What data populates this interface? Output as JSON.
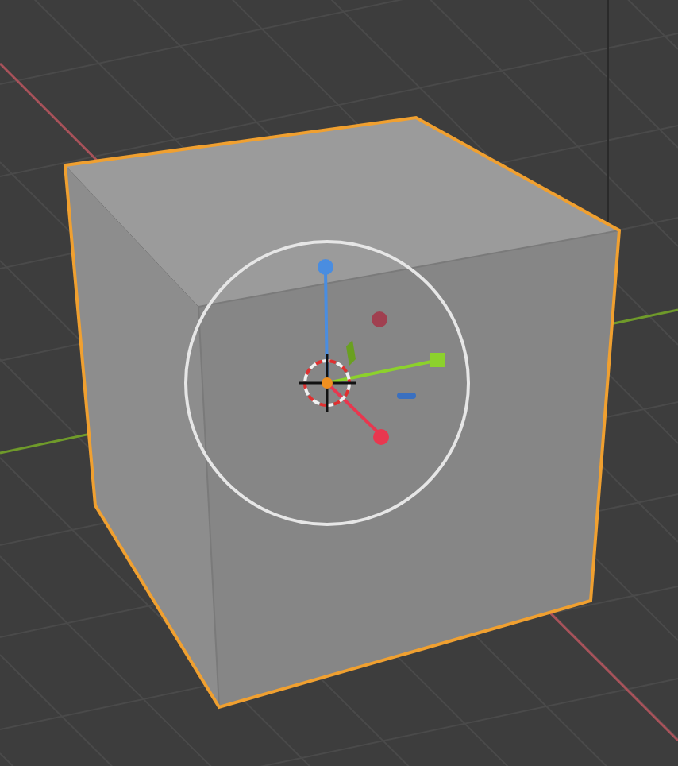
{
  "viewport": {
    "object": {
      "selected": true
    },
    "gizmo": {
      "kind": "move"
    }
  }
}
